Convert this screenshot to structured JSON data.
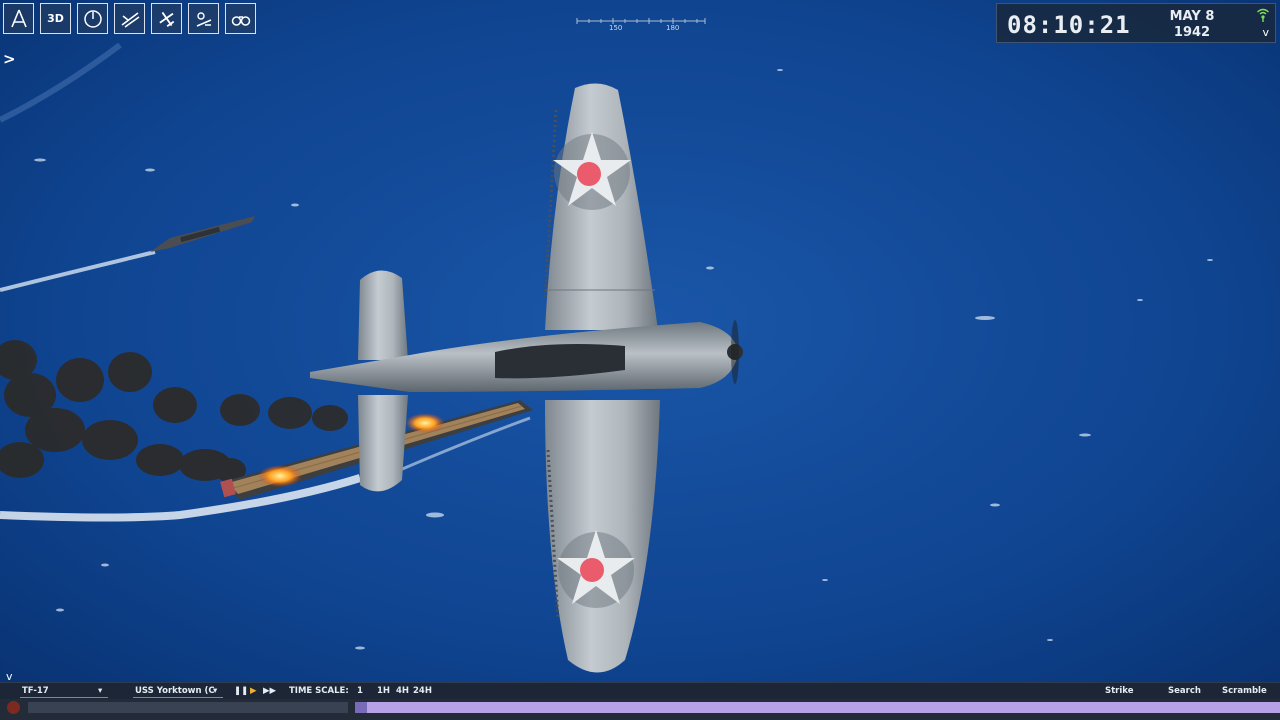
{
  "toolbar": {
    "buttons": [
      {
        "name": "compass-icon",
        "label": ""
      },
      {
        "name": "view-3d-button",
        "label": "3D"
      },
      {
        "name": "radar-icon",
        "label": ""
      },
      {
        "name": "fleet-icon",
        "label": ""
      },
      {
        "name": "aircraft-icon",
        "label": ""
      },
      {
        "name": "air-ops-icon",
        "label": ""
      },
      {
        "name": "binoculars-icon",
        "label": ""
      }
    ],
    "expand": ">"
  },
  "heading": {
    "marks": [
      "150",
      "180"
    ]
  },
  "clock": {
    "time": "08:10:21",
    "month_day": "MAY 8",
    "year": "1942",
    "chevron": "v"
  },
  "bottom": {
    "task_force": "TF-17",
    "ship": "USS Yorktown (C",
    "time_scale_label": "TIME SCALE:",
    "scales": [
      "1",
      "1H",
      "4H",
      "24H"
    ],
    "actions": [
      "Strike",
      "Search",
      "Scramble"
    ],
    "collapse": "v"
  },
  "colors": {
    "ocean": "#0f3f86",
    "timeline": "#b6a2e4",
    "aircraft": "#9aa2aa",
    "roundel_star": "#e8ecef",
    "roundel_center": "#ea5b6b"
  }
}
